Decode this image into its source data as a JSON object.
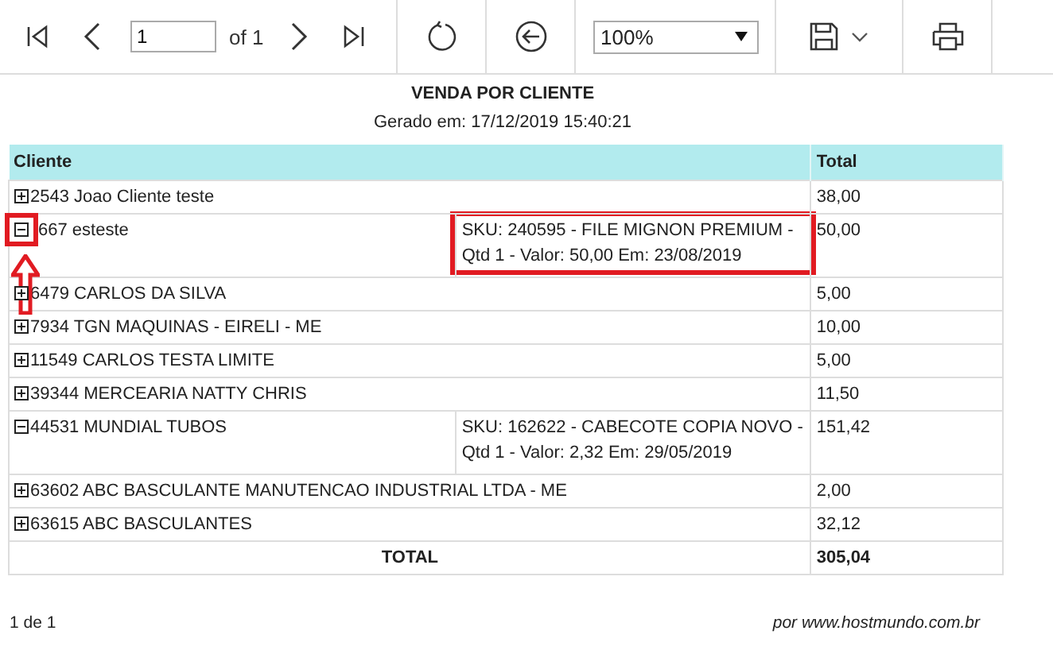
{
  "toolbar": {
    "page": "1",
    "page_count": "of 1",
    "zoom": "100%"
  },
  "report": {
    "title": "VENDA POR CLIENTE",
    "generated": "Gerado em: 17/12/2019 15:40:21"
  },
  "table": {
    "columns": [
      "Cliente",
      "Total"
    ],
    "rows": [
      {
        "client": "2543 Joao Cliente teste",
        "expanded": false,
        "total": "38,00"
      },
      {
        "client": "667 esteste",
        "expanded": true,
        "annotated": true,
        "detail": "SKU: 240595 - FILE MIGNON PREMIUM - Qtd 1 - Valor: 50,00 Em: 23/08/2019",
        "total": "50,00"
      },
      {
        "client": "6479 CARLOS DA SILVA",
        "expanded": false,
        "total": "5,00"
      },
      {
        "client": "7934 TGN MAQUINAS - EIRELI - ME",
        "expanded": false,
        "total": "10,00"
      },
      {
        "client": "11549 CARLOS TESTA LIMITE",
        "expanded": false,
        "total": "5,00"
      },
      {
        "client": "39344 MERCEARIA NATTY CHRIS",
        "expanded": false,
        "total": "11,50"
      },
      {
        "client": "44531 MUNDIAL TUBOS",
        "expanded": true,
        "detail": "SKU: 162622 - CABECOTE COPIA NOVO - Qtd 1 - Valor: 2,32 Em: 29/05/2019",
        "total": "151,42"
      },
      {
        "client": "63602 ABC BASCULANTE MANUTENCAO INDUSTRIAL LTDA - ME",
        "expanded": false,
        "total": "2,00"
      },
      {
        "client": "63615 ABC BASCULANTES",
        "expanded": false,
        "total": "32,12"
      }
    ],
    "total_label": "TOTAL",
    "total_value": "305,04"
  },
  "footer": {
    "pages": "1 de 1",
    "credit": "por www.hostmundo.com.br"
  }
}
